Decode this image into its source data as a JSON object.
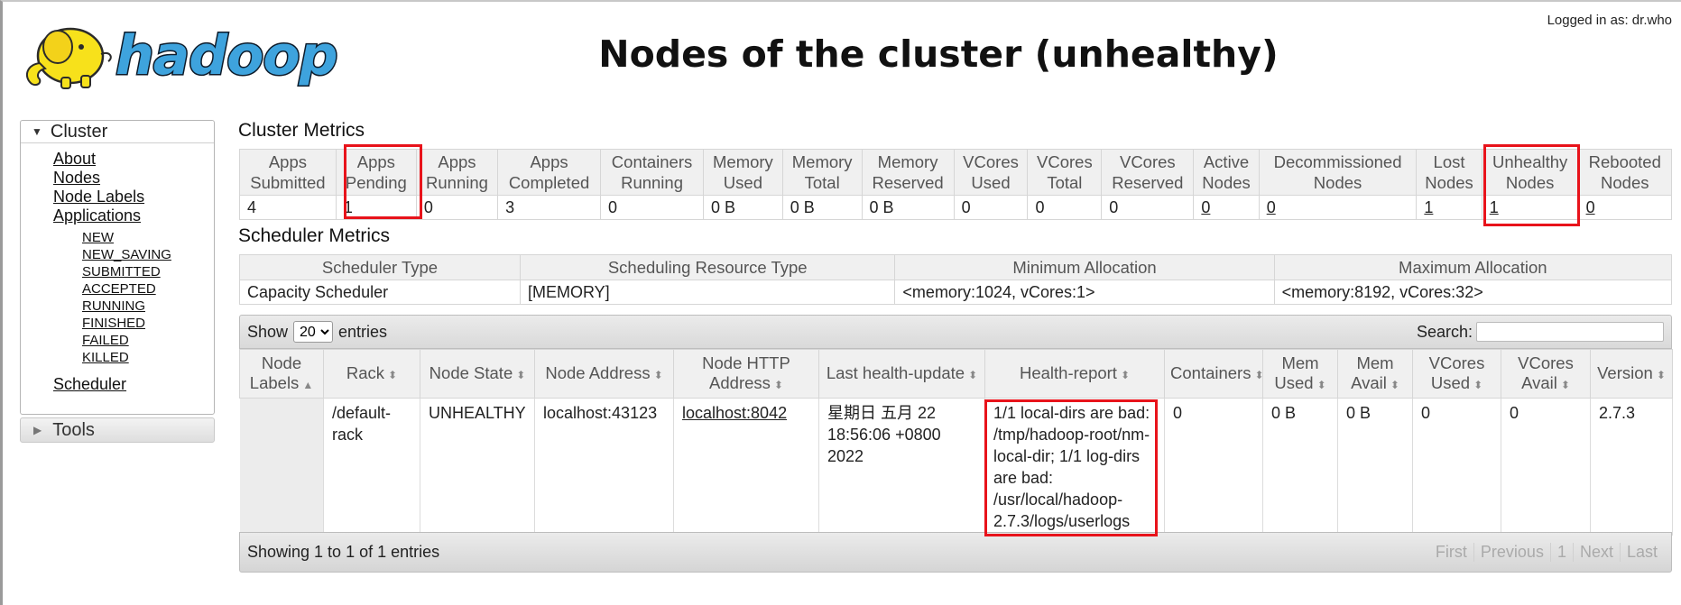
{
  "header": {
    "logo_text": "hadoop",
    "title": "Nodes of the cluster (unhealthy)",
    "logged_in": "Logged in as: dr.who"
  },
  "sidebar": {
    "cluster_label": "Cluster",
    "links": [
      "About",
      "Nodes",
      "Node Labels",
      "Applications"
    ],
    "app_states": [
      "NEW",
      "NEW_SAVING",
      "SUBMITTED",
      "ACCEPTED",
      "RUNNING",
      "FINISHED",
      "FAILED",
      "KILLED"
    ],
    "scheduler_link": "Scheduler",
    "tools_label": "Tools"
  },
  "cluster_metrics": {
    "title": "Cluster Metrics",
    "headers": [
      [
        "Apps",
        "Submitted"
      ],
      [
        "Apps",
        "Pending"
      ],
      [
        "Apps",
        "Running"
      ],
      [
        "Apps",
        "Completed"
      ],
      [
        "Containers",
        "Running"
      ],
      [
        "Memory",
        "Used"
      ],
      [
        "Memory",
        "Total"
      ],
      [
        "Memory",
        "Reserved"
      ],
      [
        "VCores",
        "Used"
      ],
      [
        "VCores",
        "Total"
      ],
      [
        "VCores",
        "Reserved"
      ],
      [
        "Active",
        "Nodes"
      ],
      [
        "Decommissioned",
        "Nodes"
      ],
      [
        "Lost",
        "Nodes"
      ],
      [
        "Unhealthy",
        "Nodes"
      ],
      [
        "Rebooted",
        "Nodes"
      ]
    ],
    "values": [
      "4",
      "1",
      "0",
      "3",
      "0",
      "0 B",
      "0 B",
      "0 B",
      "0",
      "0",
      "0",
      "0",
      "0",
      "1",
      "1",
      "0"
    ]
  },
  "scheduler_metrics": {
    "title": "Scheduler Metrics",
    "headers": [
      "Scheduler Type",
      "Scheduling Resource Type",
      "Minimum Allocation",
      "Maximum Allocation"
    ],
    "values": [
      "Capacity Scheduler",
      "[MEMORY]",
      "<memory:1024, vCores:1>",
      "<memory:8192, vCores:32>"
    ]
  },
  "nodes_table": {
    "show_label": "Show",
    "entries_label": "entries",
    "page_size": "20",
    "search_label": "Search:",
    "search_value": "",
    "columns": [
      [
        "Node",
        "Labels"
      ],
      [
        "Rack"
      ],
      [
        "Node State"
      ],
      [
        "Node Address"
      ],
      [
        "Node HTTP",
        "Address"
      ],
      [
        "Last health-update"
      ],
      [
        "Health-report"
      ],
      [
        "Containers"
      ],
      [
        "Mem",
        "Used"
      ],
      [
        "Mem",
        "Avail"
      ],
      [
        "VCores",
        "Used"
      ],
      [
        "VCores",
        "Avail"
      ],
      [
        "Version"
      ]
    ],
    "row": {
      "node_labels": "",
      "rack": "/default-rack",
      "node_state": "UNHEALTHY",
      "node_address": "localhost:43123",
      "node_http_address": "localhost:8042",
      "last_health_update": "星期日 五月 22 18:56:06 +0800 2022",
      "health_report": "1/1 local-dirs are bad: /tmp/hadoop-root/nm-local-dir; 1/1 log-dirs are bad: /usr/local/hadoop-2.7.3/logs/userlogs",
      "containers": "0",
      "mem_used": "0 B",
      "mem_avail": "0 B",
      "vcores_used": "0",
      "vcores_avail": "0",
      "version": "2.7.3"
    },
    "info": "Showing 1 to 1 of 1 entries",
    "pager": [
      "First",
      "Previous",
      "1",
      "Next",
      "Last"
    ]
  },
  "colors": {
    "highlight": "#e8131b",
    "logo_yellow": "#f7e11b",
    "logo_blue": "#3ea3dd"
  }
}
